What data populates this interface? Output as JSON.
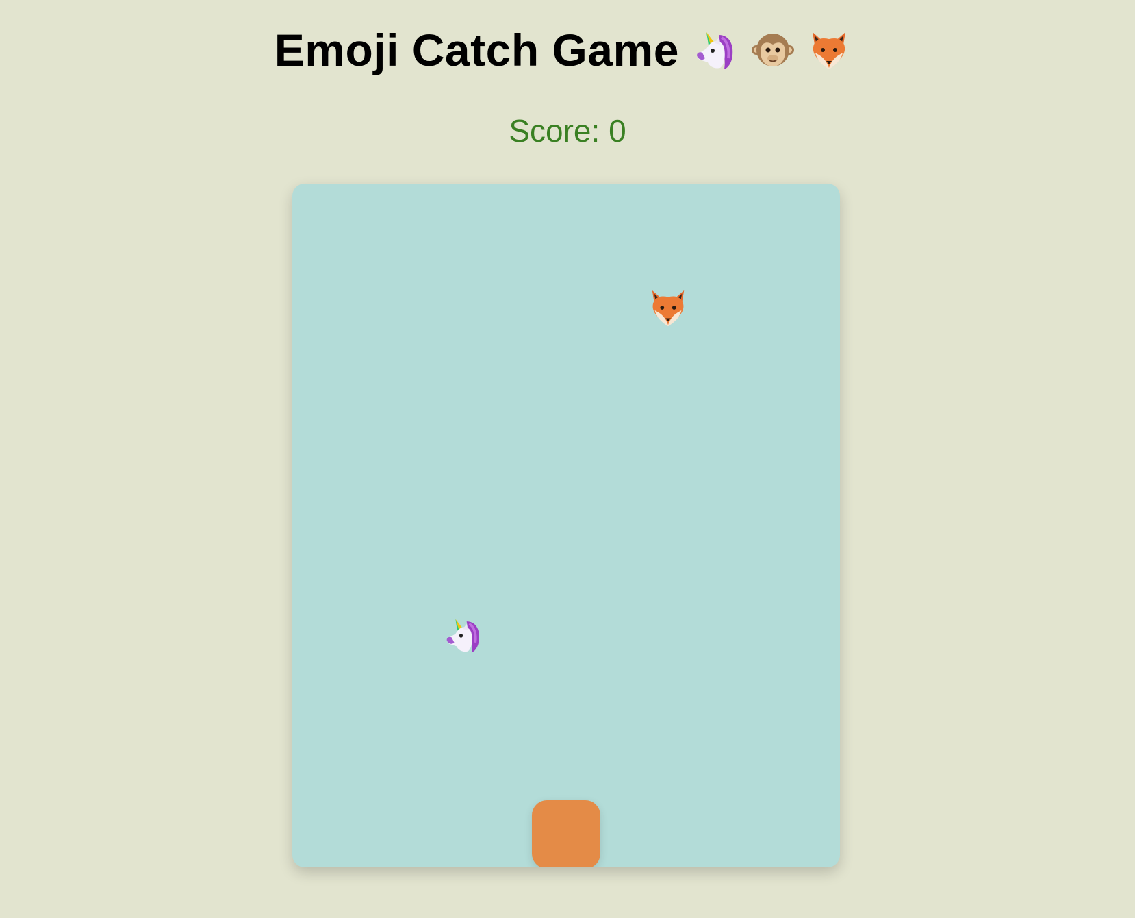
{
  "header": {
    "title": "Emoji Catch Game",
    "emojis": [
      "unicorn-icon",
      "monkey-icon",
      "fox-icon"
    ]
  },
  "score": {
    "text": "Score: 0",
    "value": 0
  },
  "game": {
    "falling_items": [
      "fox-icon",
      "unicorn-icon"
    ]
  },
  "colors": {
    "background": "#e2e4cf",
    "game_area": "#b3dcd8",
    "score_text": "#3a8023",
    "catcher": "#e48b47"
  }
}
